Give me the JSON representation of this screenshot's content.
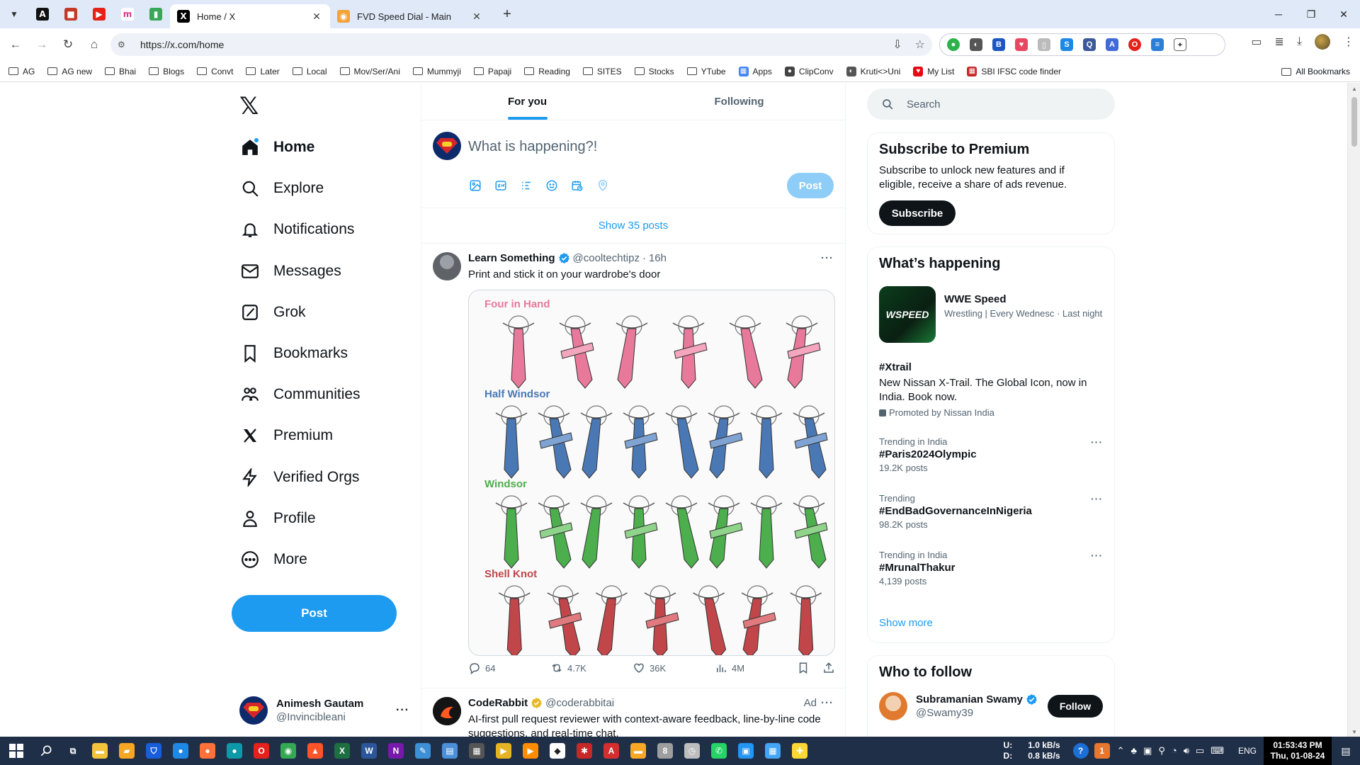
{
  "browser": {
    "tabs": [
      {
        "title": "Home / X",
        "favicon": "x-icon",
        "active": true
      },
      {
        "title": "FVD Speed Dial - Main",
        "favicon": "speed-dial-icon",
        "active": false
      }
    ],
    "url": "https://x.com/home",
    "bookmarks": [
      "AG",
      "AG new",
      "Bhai",
      "Blogs",
      "Convt",
      "Later",
      "Local",
      "Mov/Ser/Ani",
      "Mummyji",
      "Papaji",
      "Reading",
      "SITES",
      "Stocks",
      "YTube",
      "Apps",
      "ClipConv",
      "Kruti<>Uni",
      "My List",
      "SBI IFSC code finder"
    ],
    "all_bookmarks": "All Bookmarks"
  },
  "nav": {
    "items": [
      {
        "label": "Home",
        "icon": "home-icon"
      },
      {
        "label": "Explore",
        "icon": "search-icon"
      },
      {
        "label": "Notifications",
        "icon": "bell-icon"
      },
      {
        "label": "Messages",
        "icon": "envelope-icon"
      },
      {
        "label": "Grok",
        "icon": "grok-icon"
      },
      {
        "label": "Bookmarks",
        "icon": "bookmark-icon"
      },
      {
        "label": "Communities",
        "icon": "people-icon"
      },
      {
        "label": "Premium",
        "icon": "x-icon"
      },
      {
        "label": "Verified Orgs",
        "icon": "lightning-icon"
      },
      {
        "label": "Profile",
        "icon": "person-icon"
      },
      {
        "label": "More",
        "icon": "more-circle-icon"
      }
    ],
    "post_label": "Post",
    "user": {
      "name": "Animesh Gautam",
      "handle": "@Invincibleani"
    }
  },
  "feed": {
    "tabs": [
      "For you",
      "Following"
    ],
    "compose_placeholder": "What is happening?!",
    "compose_post": "Post",
    "show_posts": "Show 35 posts",
    "tweets": [
      {
        "name": "Learn Something",
        "handle": "@cooltechtipz",
        "time": "16h",
        "text": "Print and stick it on your wardrobe's door",
        "media_sections": [
          "Four in Hand",
          "Half Windsor",
          "Windsor",
          "Shell Knot"
        ],
        "replies": "64",
        "reposts": "4.7K",
        "likes": "36K",
        "views": "4M"
      },
      {
        "name": "CodeRabbit",
        "handle": "@coderabbitai",
        "ad": "Ad",
        "text": "AI-first pull request reviewer with context-aware feedback, line-by-line code suggestions, and real-time chat."
      }
    ]
  },
  "sidebar": {
    "search_placeholder": "Search",
    "premium": {
      "title": "Subscribe to Premium",
      "text": "Subscribe to unlock new features and if eligible, receive a share of ads revenue.",
      "button": "Subscribe"
    },
    "happening": {
      "title": "What’s happening",
      "event": {
        "title": "WWE Speed",
        "sub": "Wrestling | Every Wednesc · Last night",
        "image_text": "WSPEED"
      },
      "promoted": {
        "tag": "#Xtrail",
        "desc": "New Nissan X-Trail. The Global Icon, now in India. Book now.",
        "by": "Promoted by Nissan India"
      },
      "trends": [
        {
          "context": "Trending in India",
          "name": "#Paris2024Olympic",
          "count": "19.2K posts"
        },
        {
          "context": "Trending",
          "name": "#EndBadGovernanceInNigeria",
          "count": "98.2K posts"
        },
        {
          "context": "Trending in India",
          "name": "#MrunalThakur",
          "count": "4,139 posts"
        }
      ],
      "show_more": "Show more"
    },
    "who_to_follow": {
      "title": "Who to follow",
      "user": {
        "name": "Subramanian Swamy",
        "handle": "@Swamy39",
        "button": "Follow"
      }
    }
  },
  "taskbar": {
    "net_up_label": "U:",
    "net_up": "1.0 kB/s",
    "net_down_label": "D:",
    "net_down": "0.8 kB/s",
    "lang": "ENG",
    "time": "01:53:43 PM",
    "date": "Thu, 01-08-24"
  },
  "colors": {
    "accent": "#1d9bf0",
    "text": "#0f1419",
    "muted": "#536471",
    "taskbar": "#1f2f48"
  }
}
